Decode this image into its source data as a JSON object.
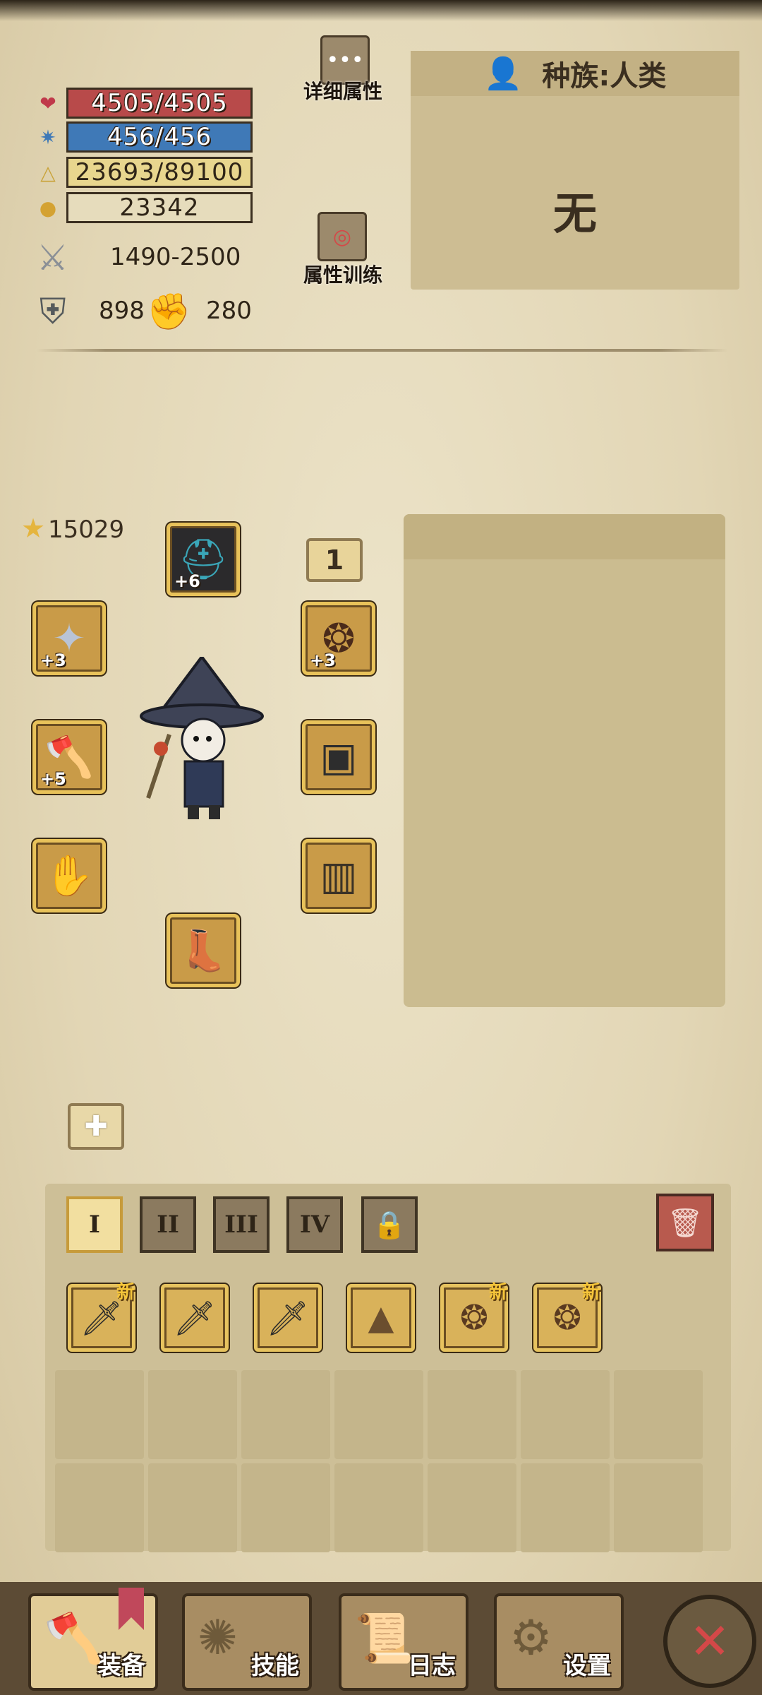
{
  "stats": {
    "hp": "4505/4505",
    "mp": "456/456",
    "xp": "23693/89100",
    "gold": "23342",
    "attack": "1490-2500",
    "defense": "898",
    "luck": "280",
    "power": "15029"
  },
  "buttons": {
    "detail_attrs": "详细属性",
    "attr_training": "属性训练"
  },
  "race": {
    "header": "种族:人类",
    "value": "无"
  },
  "equipment": {
    "tier_badge": "1",
    "helmet_plus": "+6",
    "amulet_plus": "+3",
    "ring_plus": "+3",
    "weapon_plus": "+5"
  },
  "inventory": {
    "tabs": [
      "I",
      "II",
      "III",
      "IV"
    ],
    "new_label": "新"
  },
  "nav": {
    "equip": "装备",
    "skills": "技能",
    "log": "日志",
    "settings": "设置"
  },
  "colors": {
    "hp": "#b84a4a",
    "mp": "#3f79b7",
    "xp": "#e8d68e",
    "slot_border": "#e8c25a"
  }
}
